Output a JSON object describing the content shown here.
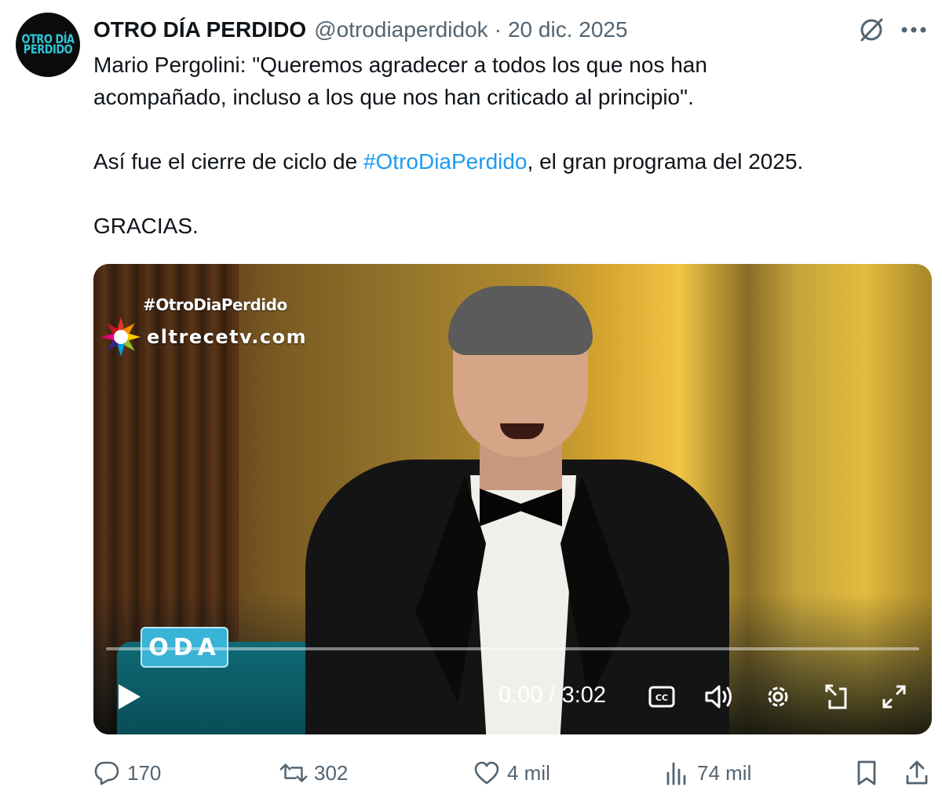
{
  "avatar": {
    "line1": "OTRO DÍA",
    "line2": "PERDIDO"
  },
  "header": {
    "display_name": "OTRO DÍA PERDIDO",
    "handle": "@otrodiaperdidok",
    "separator": "·",
    "date": "20 dic. 2025",
    "grok_icon": "grok-icon",
    "more_icon": "more-icon"
  },
  "text": {
    "line1": "Mario Pergolini: \"Queremos agradecer a todos los que nos han",
    "line2": "acompañado, incluso a los que nos han criticado al principio\".",
    "line3_before": "Así fue el cierre de ciclo de ",
    "hashtag": "#OtroDiaPerdido",
    "line3_after": ", el gran programa del 2025.",
    "line4": "GRACIAS."
  },
  "video": {
    "overlay_hashtag": "#OtroDiaPerdido",
    "overlay_brand": "eltrecetv.com",
    "show_logo": "ODA",
    "time": "0:00 / 3:02",
    "progress": 0.0,
    "icons": {
      "play": "play-icon",
      "captions": "closed-captions-icon",
      "volume": "volume-icon",
      "settings": "settings-gear-icon",
      "dock": "picture-in-picture-icon",
      "fullscreen": "fullscreen-icon"
    }
  },
  "actions": {
    "replies": "170",
    "reposts": "302",
    "likes": "4 mil",
    "views": "74 mil"
  },
  "colors": {
    "text": "#0f1419",
    "secondary": "#536471",
    "link": "#1d9bf0",
    "avatar_text": "#2ec4d6"
  }
}
